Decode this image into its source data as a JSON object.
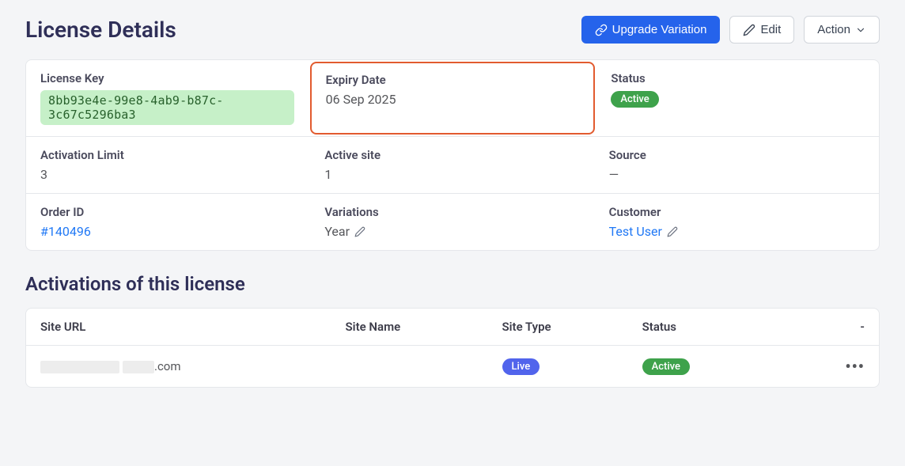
{
  "header": {
    "title": "License Details",
    "upgrade_label": "Upgrade Variation",
    "edit_label": "Edit",
    "action_label": "Action"
  },
  "details": {
    "license_key_label": "License Key",
    "license_key_value": "8bb93e4e-99e8-4ab9-b87c-3c67c5296ba3",
    "expiry_label": "Expiry Date",
    "expiry_value": "06 Sep 2025",
    "status_label": "Status",
    "status_badge": "Active",
    "activation_limit_label": "Activation Limit",
    "activation_limit_value": "3",
    "active_site_label": "Active site",
    "active_site_value": "1",
    "source_label": "Source",
    "source_value": "—",
    "order_id_label": "Order ID",
    "order_id_value": "#140496",
    "variations_label": "Variations",
    "variations_value": "Year",
    "customer_label": "Customer",
    "customer_value": "Test User"
  },
  "activations": {
    "title": "Activations of this license",
    "columns": {
      "site_url": "Site URL",
      "site_name": "Site Name",
      "site_type": "Site Type",
      "status": "Status",
      "actions": "-"
    },
    "rows": [
      {
        "url_suffix": ".com",
        "name": "",
        "type_badge": "Live",
        "status_badge": "Active"
      }
    ]
  }
}
